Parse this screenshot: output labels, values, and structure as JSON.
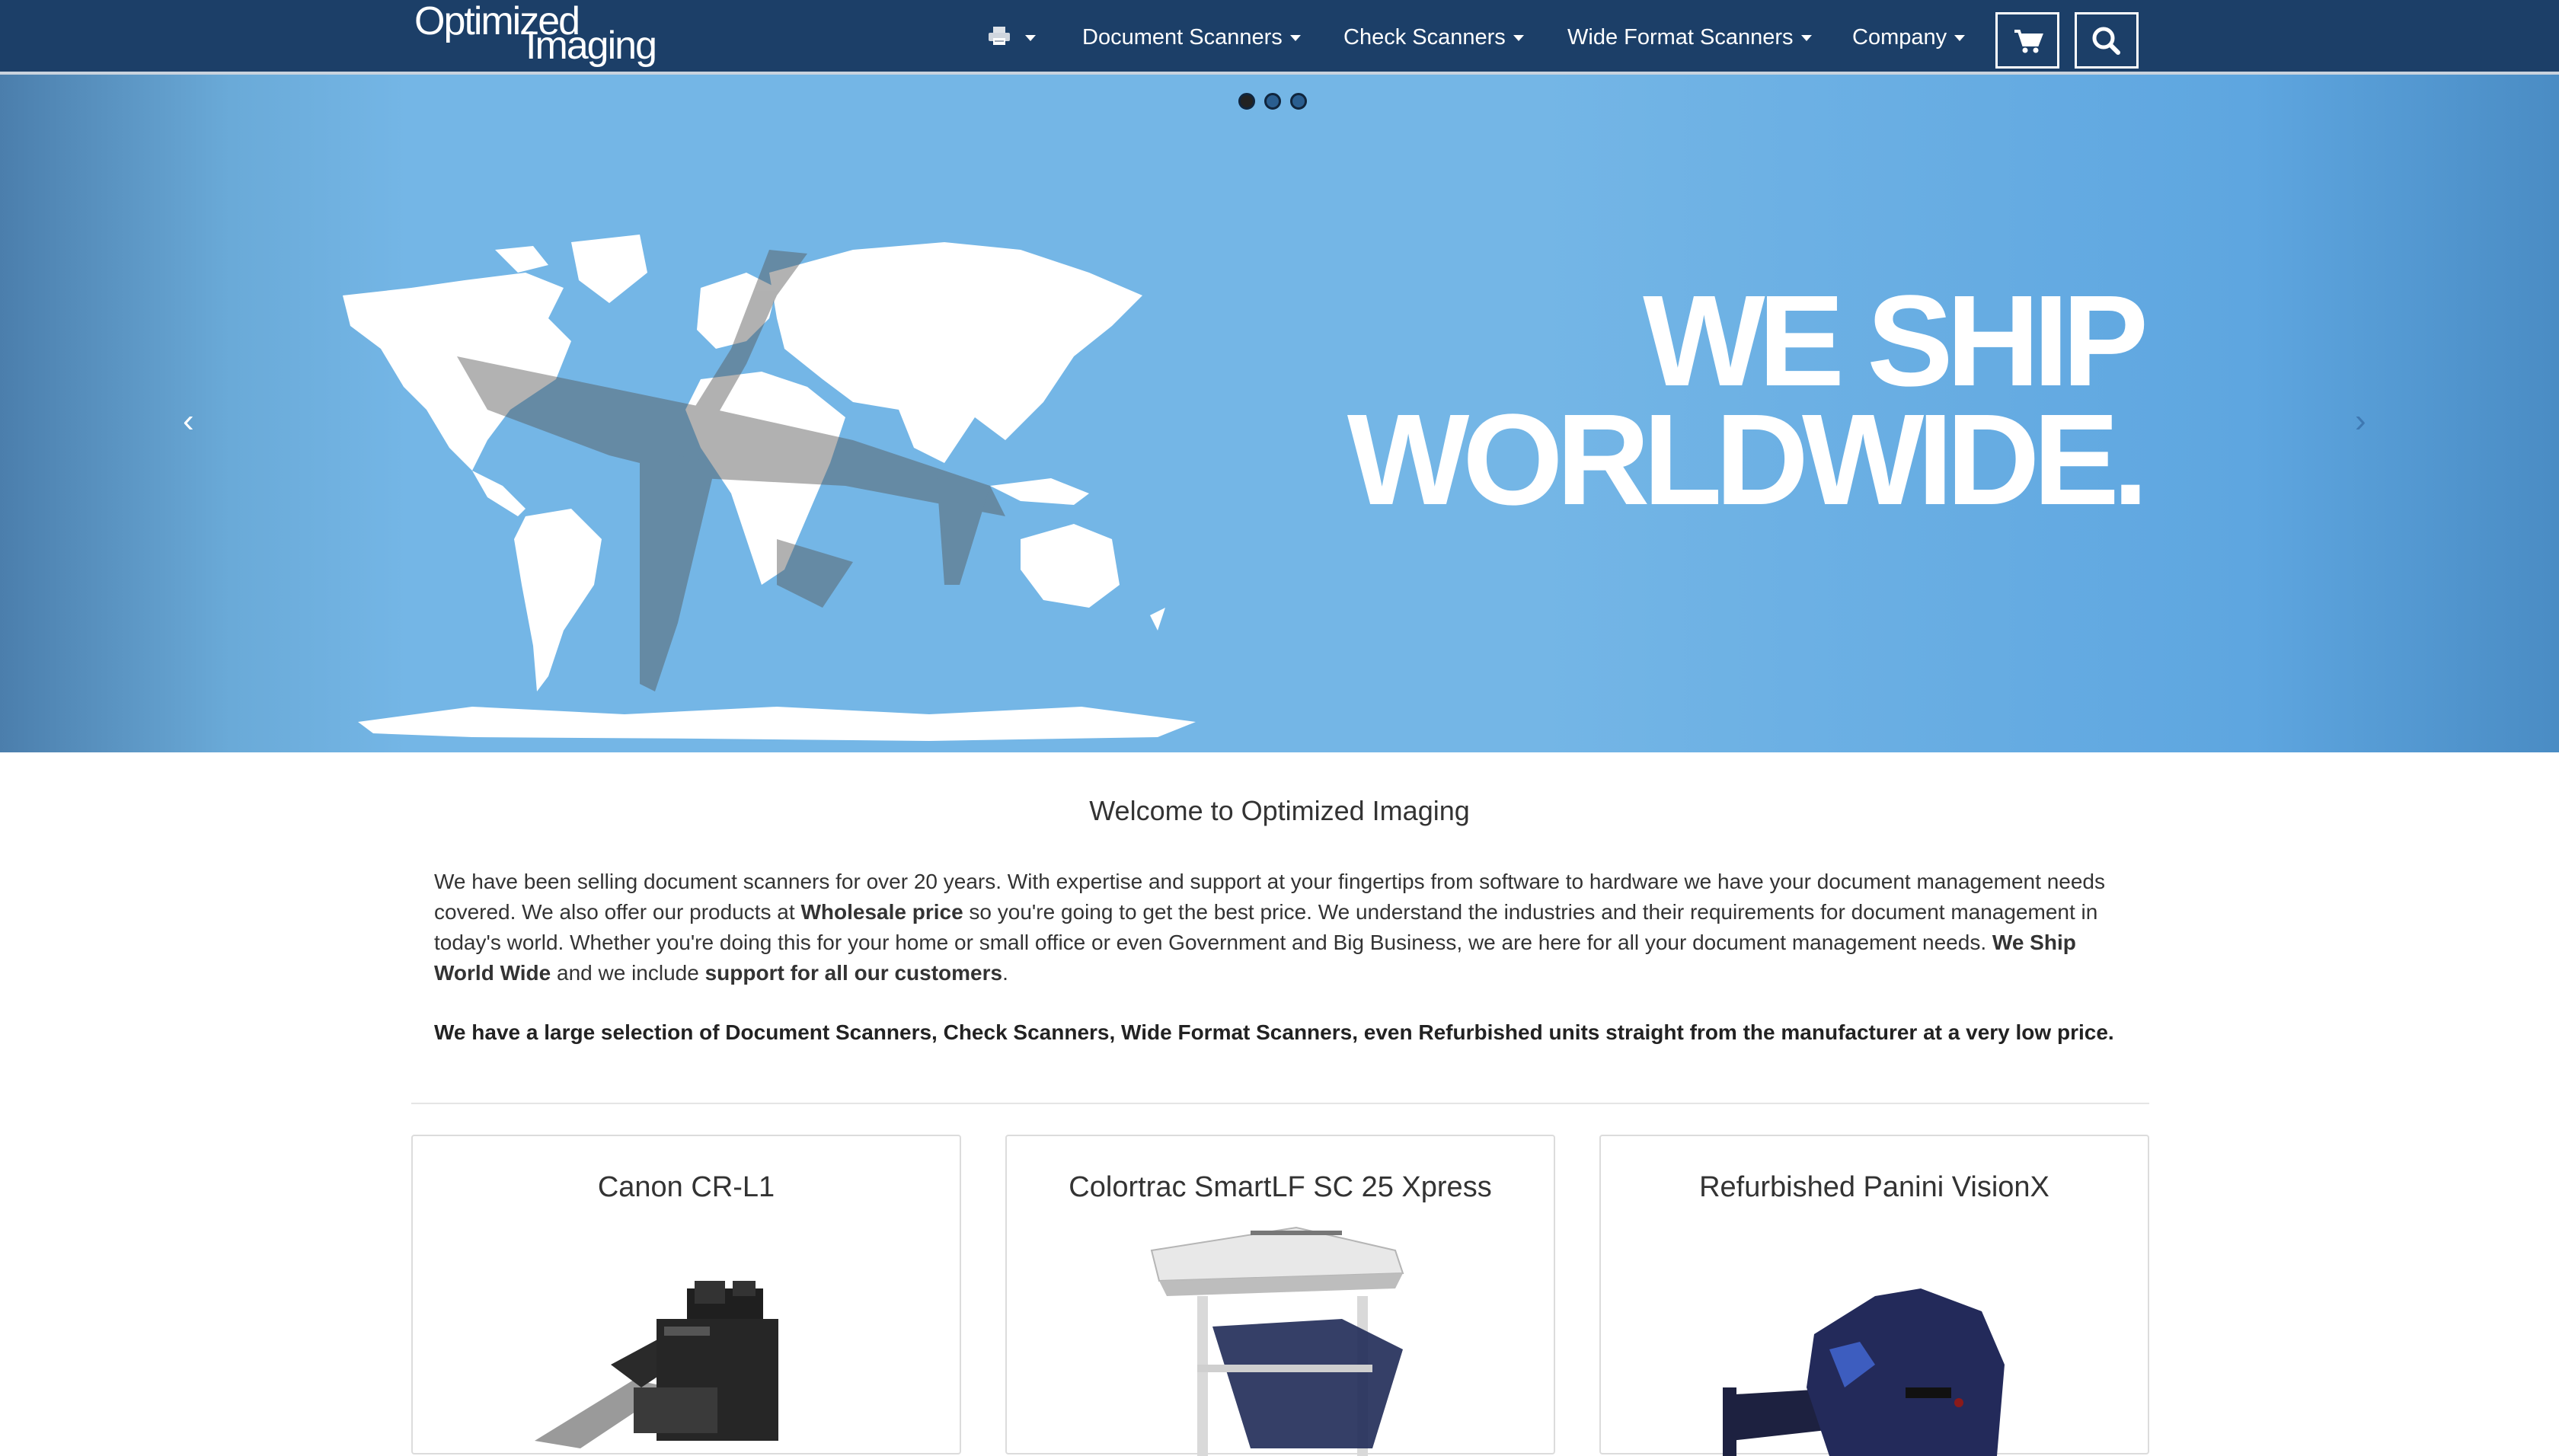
{
  "header": {
    "logo_line1": "Optimized",
    "logo_line2": "Imaging",
    "nav": [
      {
        "label": "Document Scanners"
      },
      {
        "label": "Check Scanners"
      },
      {
        "label": "Wide Format Scanners"
      },
      {
        "label": "Company"
      }
    ],
    "icons": {
      "printer": "printer-icon",
      "cart": "cart-icon",
      "search": "search-icon"
    }
  },
  "hero": {
    "headline_line1": "WE SHIP",
    "headline_line2": "WORLDWIDE.",
    "slide_count": 3,
    "active_slide": 1,
    "prev_arrow": "‹",
    "next_arrow": "›"
  },
  "welcome": {
    "title": "Welcome to Optimized Imaging",
    "p1_a": "We have been selling document scanners for over 20 years. With expertise and support at your fingertips from software to hardware we have your document management needs covered. We also offer our products at ",
    "p1_b": "Wholesale price",
    "p1_c": " so you're going to get the best price. We understand the industries and their requirements for document management in today's world. Whether you're doing this for your home or small office or even Government and Big Business, we are here for all your document management needs. ",
    "p1_d": "We Ship World Wide",
    "p1_e": " and we include ",
    "p1_f": "support for all our customers",
    "p1_g": ".",
    "p2": "We have a large selection of Document Scanners, Check Scanners, Wide Format Scanners, even Refurbished units straight from the manufacturer at a very low price."
  },
  "products": [
    {
      "title": "Canon CR-L1"
    },
    {
      "title": "Colortrac SmartLF SC 25 Xpress"
    },
    {
      "title": "Refurbished Panini VisionX"
    }
  ],
  "colors": {
    "navbar": "#1c3f68",
    "hero_blue": "#74b6e6",
    "text": "#333333"
  }
}
